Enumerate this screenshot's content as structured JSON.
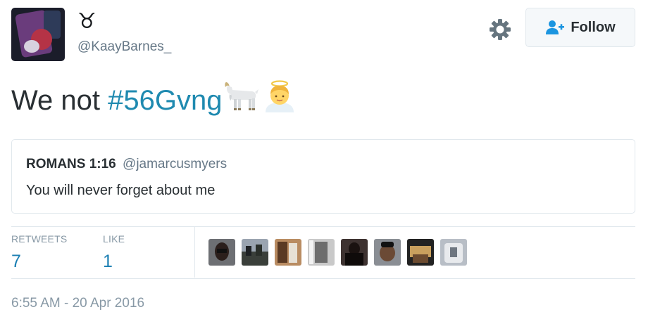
{
  "author": {
    "display_name": "♉",
    "screen_name": "@KaayBarnes_"
  },
  "actions": {
    "follow_label": "Follow"
  },
  "tweet": {
    "text_prefix": "We not ",
    "hashtag": "#56Gvng",
    "emojis": [
      "goat-emoji",
      "angel-emoji"
    ]
  },
  "quoted_tweet": {
    "name": "ROMANS 1:16",
    "handle": "@jamarcusmyers",
    "text": "You will never forget about me"
  },
  "stats": {
    "retweets_label": "RETWEETS",
    "retweets_count": "7",
    "likes_label": "LIKE",
    "likes_count": "1"
  },
  "likers_count": 8,
  "timestamp": "6:55 AM - 20 Apr 2016",
  "colors": {
    "hashtag": "#1f8ab0",
    "stat_value": "#1b7fb3",
    "border": "#e1e8ed",
    "muted": "#657786"
  }
}
